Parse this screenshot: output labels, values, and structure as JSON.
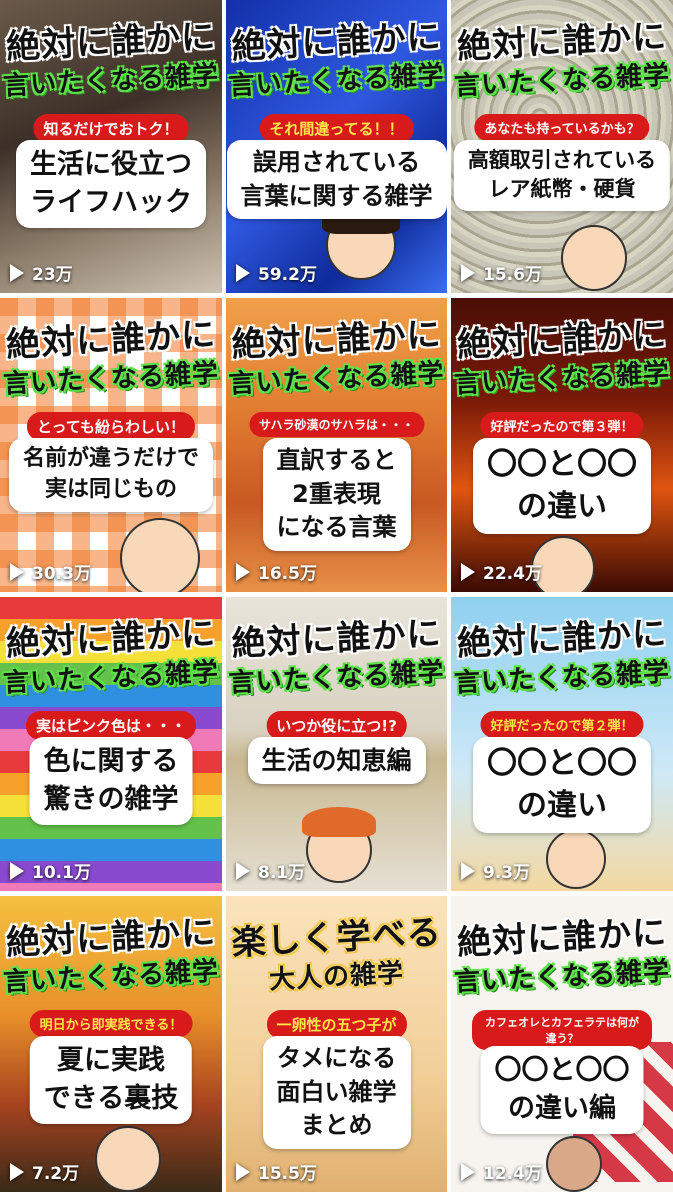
{
  "tiles": [
    {
      "line1": "絶対に誰かに",
      "line2": "言いたくなる雑学",
      "tag": "知るだけでおトク！",
      "caption": [
        "生活に役立つ",
        "ライフハック"
      ],
      "views": "23万"
    },
    {
      "line1": "絶対に誰かに",
      "line2": "言いたくなる雑学",
      "tag": "それ間違ってる！！",
      "caption": [
        "誤用されている",
        "言葉に関する雑学"
      ],
      "views": "59.2万"
    },
    {
      "line1": "絶対に誰かに",
      "line2": "言いたくなる雑学",
      "tag": "あなたも持っているかも？",
      "caption": [
        "高額取引されている",
        "レア紙幣・硬貨"
      ],
      "views": "15.6万"
    },
    {
      "line1": "絶対に誰かに",
      "line2": "言いたくなる雑学",
      "tag": "とっても紛らわしい！",
      "caption": [
        "名前が違うだけで",
        "実は同じもの"
      ],
      "views": "30.3万"
    },
    {
      "line1": "絶対に誰かに",
      "line2": "言いたくなる雑学",
      "tag": "サハラ砂漠のサハラは・・・",
      "caption": [
        "直訳すると",
        "2重表現",
        "になる言葉"
      ],
      "views": "16.5万"
    },
    {
      "line1": "絶対に誰かに",
      "line2": "言いたくなる雑学",
      "tag": "好評だったので第３弾！",
      "caption": [
        "〇〇と〇〇",
        "の違い"
      ],
      "views": "22.4万"
    },
    {
      "line1": "絶対に誰かに",
      "line2": "言いたくなる雑学",
      "tag": "実はピンク色は・・・",
      "caption": [
        "色に関する",
        "驚きの雑学"
      ],
      "views": "10.1万"
    },
    {
      "line1": "絶対に誰かに",
      "line2": "言いたくなる雑学",
      "tag": "いつか役に立つ!?",
      "caption": [
        "生活の知恵編"
      ],
      "views": "8.1万"
    },
    {
      "line1": "絶対に誰かに",
      "line2": "言いたくなる雑学",
      "tag": "好評だったので第２弾！",
      "caption": [
        "〇〇と〇〇",
        "の違い"
      ],
      "views": "9.3万"
    },
    {
      "line1": "絶対に誰かに",
      "line2": "言いたくなる雑学",
      "tag": "明日から即実践できる！",
      "caption": [
        "夏に実践",
        "できる裏技"
      ],
      "views": "7.2万"
    },
    {
      "line1": "楽しく学べる",
      "line2": "大人の雑学",
      "tag": "一卵性の五つ子が",
      "caption": [
        "タメになる",
        "面白い雑学",
        "まとめ"
      ],
      "views": "15.5万"
    },
    {
      "line1": "絶対に誰かに",
      "line2": "言いたくなる雑学",
      "tag": "カフェオレとカフェラテは何が違う？",
      "caption": [
        "〇〇と〇〇",
        "の違い編"
      ],
      "views": "12.4万"
    }
  ],
  "icons": {
    "play": "play-icon"
  }
}
